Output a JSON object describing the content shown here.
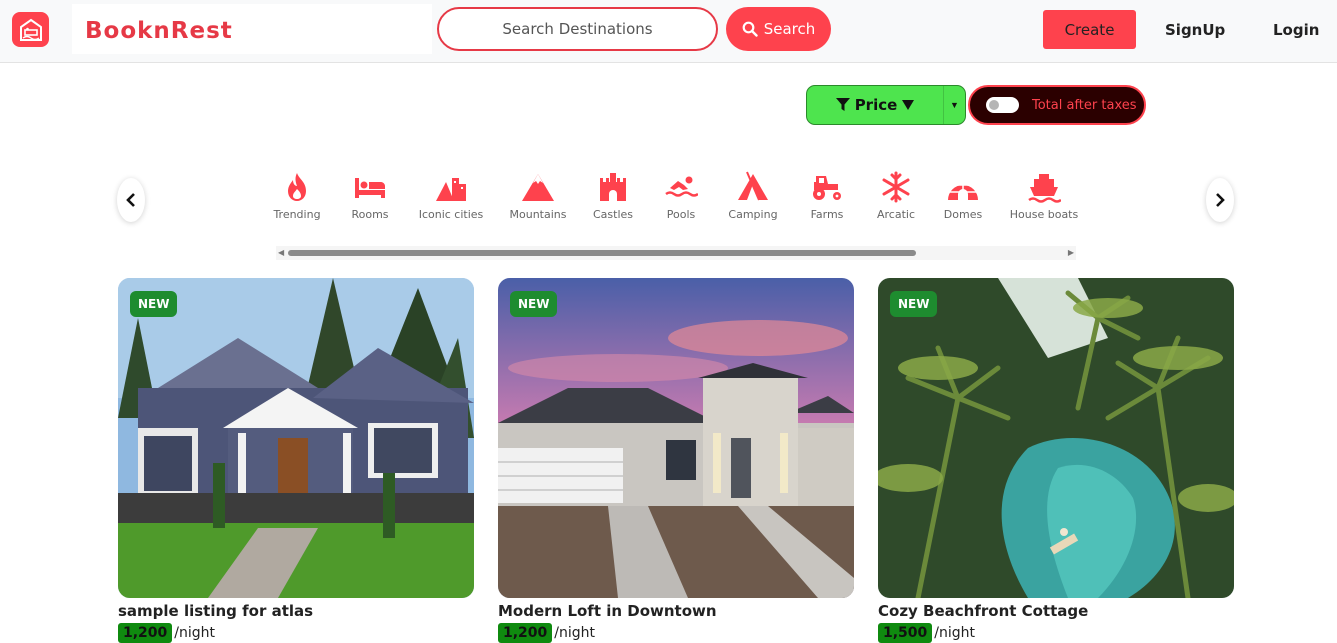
{
  "brand": {
    "name": "BooknRest"
  },
  "search": {
    "placeholder": "Search Destinations",
    "button_label": "Search"
  },
  "nav": {
    "create_label": "Create",
    "signup_label": "SignUp",
    "login_label": "Login"
  },
  "filters": {
    "price_label": "Price",
    "tax_label": "Total after taxes",
    "tax_toggle_on": false
  },
  "categories": [
    {
      "label": "Trending",
      "icon": "fire-icon"
    },
    {
      "label": "Rooms",
      "icon": "bed-icon"
    },
    {
      "label": "Iconic cities",
      "icon": "city-icon"
    },
    {
      "label": "Mountains",
      "icon": "mountain-icon"
    },
    {
      "label": "Castles",
      "icon": "castle-icon"
    },
    {
      "label": "Pools",
      "icon": "swimmer-icon"
    },
    {
      "label": "Camping",
      "icon": "tent-icon"
    },
    {
      "label": "Farms",
      "icon": "tractor-icon"
    },
    {
      "label": "Arcatic",
      "icon": "snowflake-icon"
    },
    {
      "label": "Domes",
      "icon": "igloo-icon"
    },
    {
      "label": "House boats",
      "icon": "ship-icon"
    }
  ],
  "listings": [
    {
      "badge": "NEW",
      "title": "sample listing for atlas",
      "price": "1,200",
      "per": "/night"
    },
    {
      "badge": "NEW",
      "title": "Modern Loft in Downtown",
      "price": "1,200",
      "per": "/night"
    },
    {
      "badge": "NEW",
      "title": "Cozy Beachfront Cottage",
      "price": "1,500",
      "per": "/night"
    }
  ],
  "colors": {
    "brand": "#fe424d",
    "price_btn": "#4ee44e",
    "badge": "#1e8c2f"
  }
}
